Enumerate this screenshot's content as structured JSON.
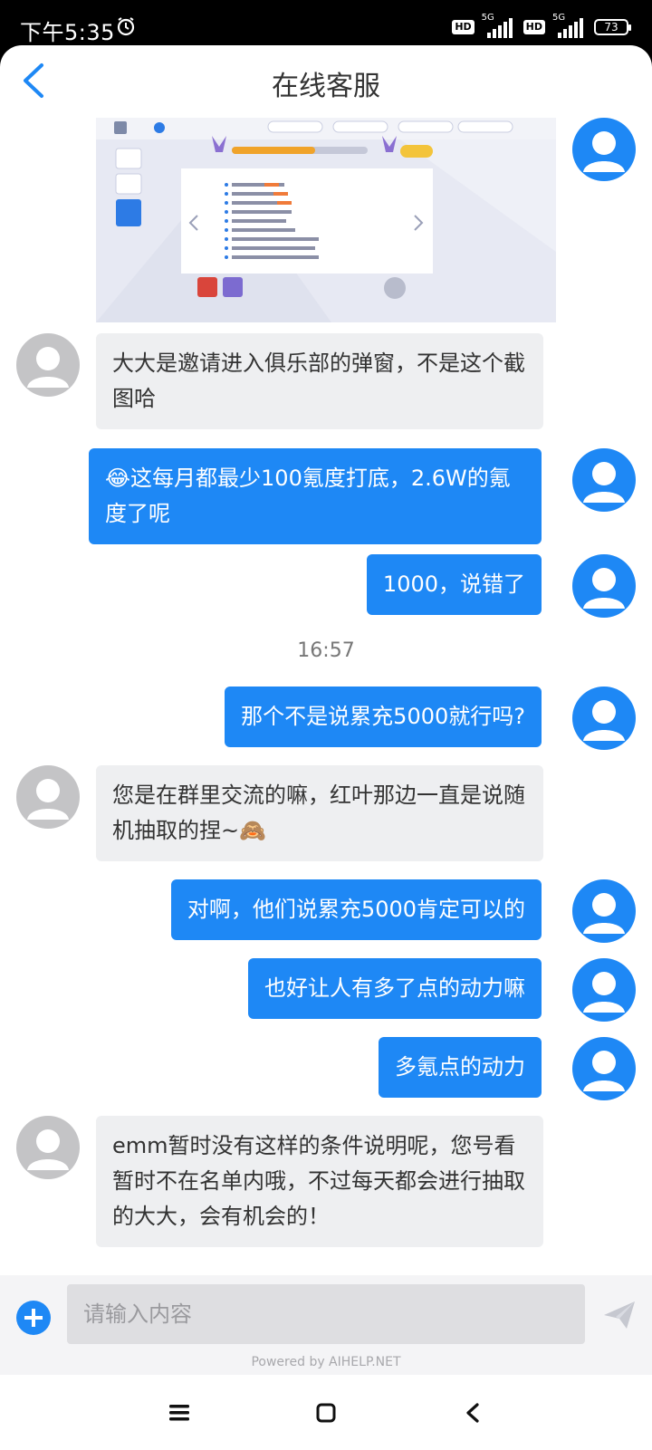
{
  "status_bar": {
    "time": "下午5:35",
    "sim1_label": "HD",
    "sim1_net": "5G",
    "sim2_label": "HD",
    "sim2_net": "5G",
    "battery": "73"
  },
  "header": {
    "title": "在线客服"
  },
  "messages": [
    {
      "from": "me",
      "type": "image",
      "icon": "game-screenshot",
      "caption": ""
    },
    {
      "from": "agent",
      "text": "大大是邀请进入俱乐部的弹窗，不是这个截图哈"
    },
    {
      "from": "me",
      "text": "😂这每月都最少100氪度打底，2.6W的氪度了呢"
    },
    {
      "from": "me",
      "text": "1000，说错了"
    },
    {
      "type": "timestamp",
      "text": "16:57"
    },
    {
      "from": "me",
      "text": "那个不是说累充5000就行吗?"
    },
    {
      "from": "agent",
      "text": "您是在群里交流的嘛，红叶那边一直是说随机抽取的捏~🙈"
    },
    {
      "from": "me",
      "text": "对啊，他们说累充5000肯定可以的"
    },
    {
      "from": "me",
      "text": "也好让人有多了点的动力嘛"
    },
    {
      "from": "me",
      "text": "多氪点的动力"
    },
    {
      "from": "agent",
      "text": "emm暂时没有这样的条件说明呢，您号看暂时不在名单内哦，不过每天都会进行抽取的大大，会有机会的！"
    }
  ],
  "input": {
    "placeholder": "请输入内容"
  },
  "footer": {
    "powered_by": "Powered by AIHELP.NET"
  },
  "colors": {
    "accent": "#1e88f5",
    "agent_bubble": "#eeeff1",
    "agent_avatar": "#c4c4c6"
  },
  "nav": {
    "icons": [
      "menu-icon",
      "home-icon",
      "back-icon"
    ]
  }
}
